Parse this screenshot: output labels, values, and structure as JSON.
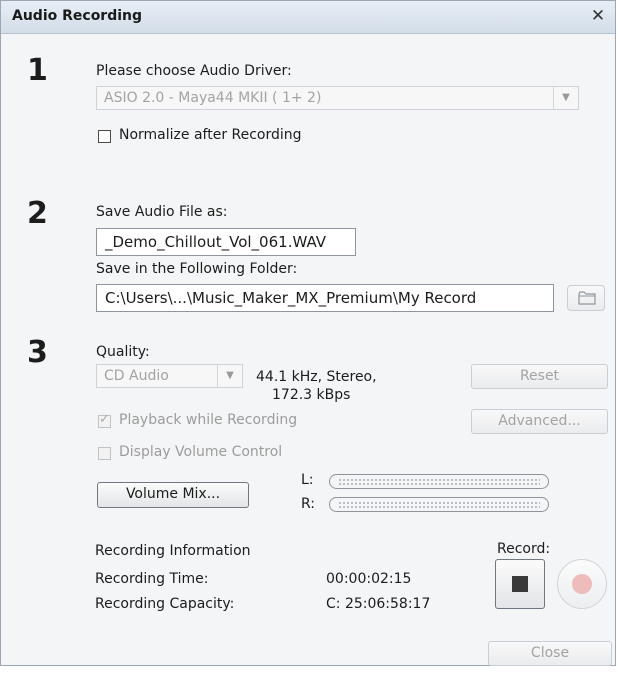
{
  "window": {
    "title": "Audio Recording",
    "close_glyph": "✕"
  },
  "steps": {
    "one": "1",
    "two": "2",
    "three": "3"
  },
  "driver": {
    "label": "Please choose Audio Driver:",
    "selected": "ASIO 2.0 - Maya44 MKII ( 1+ 2)",
    "normalize_label": "Normalize after Recording",
    "normalize_checked": false
  },
  "save": {
    "file_label": "Save Audio File as:",
    "file_value": "_Demo_Chillout_Vol_061.WAV",
    "folder_label": "Save in the Following Folder:",
    "folder_value": "C:\\Users\\...\\Music_Maker_MX_Premium\\My Record",
    "browse_icon": "folder-icon"
  },
  "quality": {
    "label": "Quality:",
    "selected": "CD Audio",
    "info_line1": "44.1 kHz, Stereo,",
    "info_line2": "172.3 kBps",
    "reset_label": "Reset",
    "advanced_label": "Advanced...",
    "playback_label": "Playback while Recording",
    "playback_checked": true,
    "display_volume_label": "Display Volume Control",
    "display_volume_checked": false,
    "volume_mix_label": "Volume Mix...",
    "meter_left_label": "L:",
    "meter_right_label": "R:",
    "meter_left_level": 0,
    "meter_right_level": 0
  },
  "info": {
    "heading": "Recording Information",
    "time_label": "Recording Time:",
    "time_value": "00:00:02:15",
    "capacity_label": "Recording Capacity:",
    "capacity_value": "C: 25:06:58:17"
  },
  "record": {
    "label": "Record:",
    "stop_icon": "stop-icon",
    "record_icon": "record-icon",
    "record_color": "#eebcbc"
  },
  "footer": {
    "close_label": "Close"
  },
  "colors": {
    "titlebar": "#d3dde8",
    "background": "#f4f5f7",
    "disabled_text": "#a3a3a3"
  }
}
